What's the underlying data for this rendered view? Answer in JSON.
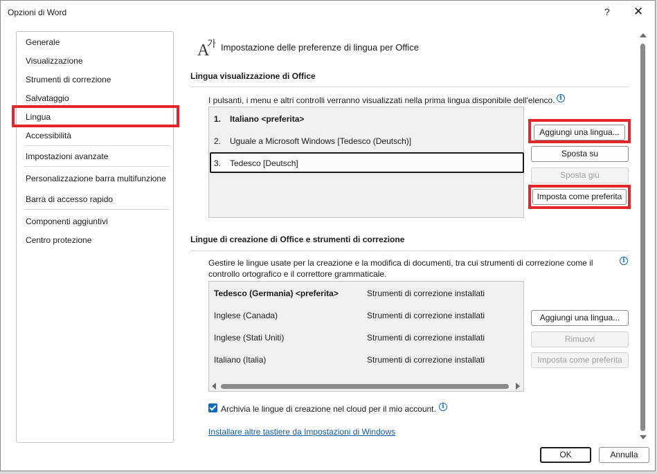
{
  "window": {
    "title": "Opzioni di Word",
    "help_glyph": "?",
    "close_glyph": "✕"
  },
  "sidebar": {
    "items": [
      {
        "label": "Generale"
      },
      {
        "label": "Visualizzazione"
      },
      {
        "label": "Strumenti di correzione"
      },
      {
        "label": "Salvataggio"
      },
      {
        "label": "Lingua"
      },
      {
        "label": "Accessibilità"
      },
      {
        "label": "Impostazioni avanzate"
      },
      {
        "label": "Personalizzazione barra multifunzione"
      },
      {
        "label": "Barra di accesso rapido"
      },
      {
        "label": "Componenti aggiuntivi"
      },
      {
        "label": "Centro protezione"
      }
    ],
    "selected": "Lingua"
  },
  "main": {
    "title": "Impostazione delle preferenze di lingua per Office",
    "display": {
      "heading": "Lingua visualizzazione di Office",
      "description": "I pulsanti, i menu e altri controlli verranno visualizzati nella prima lingua disponibile dell'elenco.",
      "languages": [
        {
          "num": "1.",
          "name": "Italiano <preferita>"
        },
        {
          "num": "2.",
          "name": "Uguale a Microsoft Windows [Tedesco (Deutsch)]"
        },
        {
          "num": "3.",
          "name": "Tedesco [Deutsch]"
        }
      ],
      "buttons": {
        "add": "Aggiungi una lingua...",
        "move_up": "Sposta su",
        "move_down": "Sposta giù",
        "set_preferred": "Imposta come preferita"
      }
    },
    "authoring": {
      "heading": "Lingue di creazione di Office e strumenti di correzione",
      "description_line1": "Gestire le lingue usate per la creazione e la modifica di documenti, tra cui strumenti di correzione come il",
      "description_line2": "controllo ortografico e il correttore grammaticale.",
      "rows": [
        {
          "language": "Tedesco (Germania) <preferita>",
          "status": "Strumenti di correzione installati"
        },
        {
          "language": "Inglese (Canada)",
          "status": "Strumenti di correzione installati"
        },
        {
          "language": "Inglese (Stati Uniti)",
          "status": "Strumenti di correzione installati"
        },
        {
          "language": "Italiano (Italia)",
          "status": "Strumenti di correzione installati"
        }
      ],
      "buttons": {
        "add": "Aggiungi una lingua...",
        "remove": "Rimuovi",
        "set_preferred": "Imposta come preferita"
      },
      "cloud_checkbox": {
        "label": "Archivia le lingue di creazione nel cloud per il mio account.",
        "checked": true
      },
      "link": "Installare altre tastiere da Impostazioni di Windows"
    }
  },
  "footer": {
    "ok": "OK",
    "cancel": "Annulla"
  },
  "colors": {
    "highlight": "#e2262c",
    "accent": "#0f6cbd",
    "link": "#0f5ba7"
  }
}
